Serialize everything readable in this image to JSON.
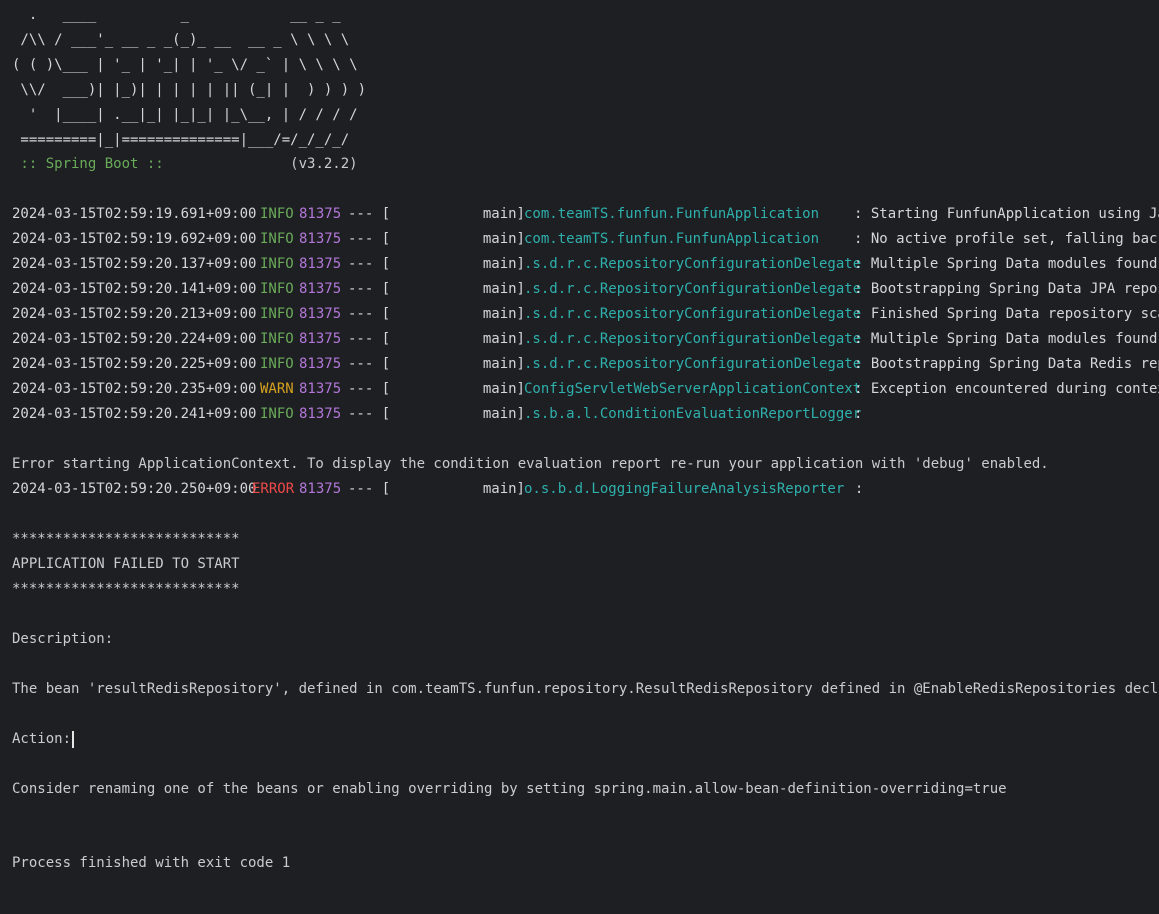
{
  "banner": [
    "  .   ____          _            __ _ _",
    " /\\\\ / ___'_ __ _ _(_)_ __  __ _ \\ \\ \\ \\",
    "( ( )\\___ | '_ | '_| | '_ \\/ _` | \\ \\ \\ \\",
    " \\\\/  ___)| |_)| | | | | || (_| |  ) ) ) )",
    "  '  |____| .__|_| |_|_| |_\\__, | / / / /",
    " =========|_|==============|___/=/_/_/_/"
  ],
  "spring_label": " :: Spring Boot :: ",
  "spring_version": "              (v3.2.2)",
  "log_lines": [
    {
      "ts": "2024-03-15T02:59:19.691+09:00",
      "level": "INFO",
      "pid": "81375",
      "sep": "--- [",
      "thread": "main]",
      "logger": "com.teamTS.funfun.FunfunApplication",
      "msg": ": Starting FunfunApplication using Java"
    },
    {
      "ts": "2024-03-15T02:59:19.692+09:00",
      "level": "INFO",
      "pid": "81375",
      "sep": "--- [",
      "thread": "main]",
      "logger": "com.teamTS.funfun.FunfunApplication",
      "msg": ": No active profile set, falling back t"
    },
    {
      "ts": "2024-03-15T02:59:20.137+09:00",
      "level": "INFO",
      "pid": "81375",
      "sep": "--- [",
      "thread": "main]",
      "logger": ".s.d.r.c.RepositoryConfigurationDelegate",
      "msg": ": Multiple Spring Data modules found, e"
    },
    {
      "ts": "2024-03-15T02:59:20.141+09:00",
      "level": "INFO",
      "pid": "81375",
      "sep": "--- [",
      "thread": "main]",
      "logger": ".s.d.r.c.RepositoryConfigurationDelegate",
      "msg": ": Bootstrapping Spring Data JPA reposit"
    },
    {
      "ts": "2024-03-15T02:59:20.213+09:00",
      "level": "INFO",
      "pid": "81375",
      "sep": "--- [",
      "thread": "main]",
      "logger": ".s.d.r.c.RepositoryConfigurationDelegate",
      "msg": ": Finished Spring Data repository scann"
    },
    {
      "ts": "2024-03-15T02:59:20.224+09:00",
      "level": "INFO",
      "pid": "81375",
      "sep": "--- [",
      "thread": "main]",
      "logger": ".s.d.r.c.RepositoryConfigurationDelegate",
      "msg": ": Multiple Spring Data modules found, e"
    },
    {
      "ts": "2024-03-15T02:59:20.225+09:00",
      "level": "INFO",
      "pid": "81375",
      "sep": "--- [",
      "thread": "main]",
      "logger": ".s.d.r.c.RepositoryConfigurationDelegate",
      "msg": ": Bootstrapping Spring Data Redis repos"
    },
    {
      "ts": "2024-03-15T02:59:20.235+09:00",
      "level": "WARN",
      "pid": "81375",
      "sep": "--- [",
      "thread": "main]",
      "logger": "ConfigServletWebServerApplicationContext",
      "msg": ": Exception encountered during context"
    },
    {
      "ts": "2024-03-15T02:59:20.241+09:00",
      "level": "INFO",
      "pid": "81375",
      "sep": "--- [",
      "thread": "main]",
      "logger": ".s.b.a.l.ConditionEvaluationReportLogger",
      "msg": ":"
    }
  ],
  "error_context": "Error starting ApplicationContext. To display the condition evaluation report re-run your application with 'debug' enabled.",
  "error_line": {
    "ts": "2024-03-15T02:59:20.250+09:00",
    "level": "ERROR",
    "pid": "81375",
    "sep": "--- [",
    "thread": "main]",
    "logger": "o.s.b.d.LoggingFailureAnalysisReporter",
    "msg": "  :"
  },
  "stars": "***************************",
  "failed_title": "APPLICATION FAILED TO START",
  "description_label": "Description:",
  "description_text": "The bean 'resultRedisRepository', defined in com.teamTS.funfun.repository.ResultRedisRepository defined in @EnableRedisRepositories declared on",
  "action_label": "Action:",
  "action_text": "Consider renaming one of the beans or enabling overriding by setting spring.main.allow-bean-definition-overriding=true",
  "exit_text": "Process finished with exit code 1",
  "colors": {
    "background": "#1e1f22",
    "text": "#d4d6dc",
    "info": "#6aab5a",
    "warn": "#d6a11e",
    "error": "#ef4a4a",
    "pid": "#b377d9",
    "logger": "#2eb0ad"
  }
}
